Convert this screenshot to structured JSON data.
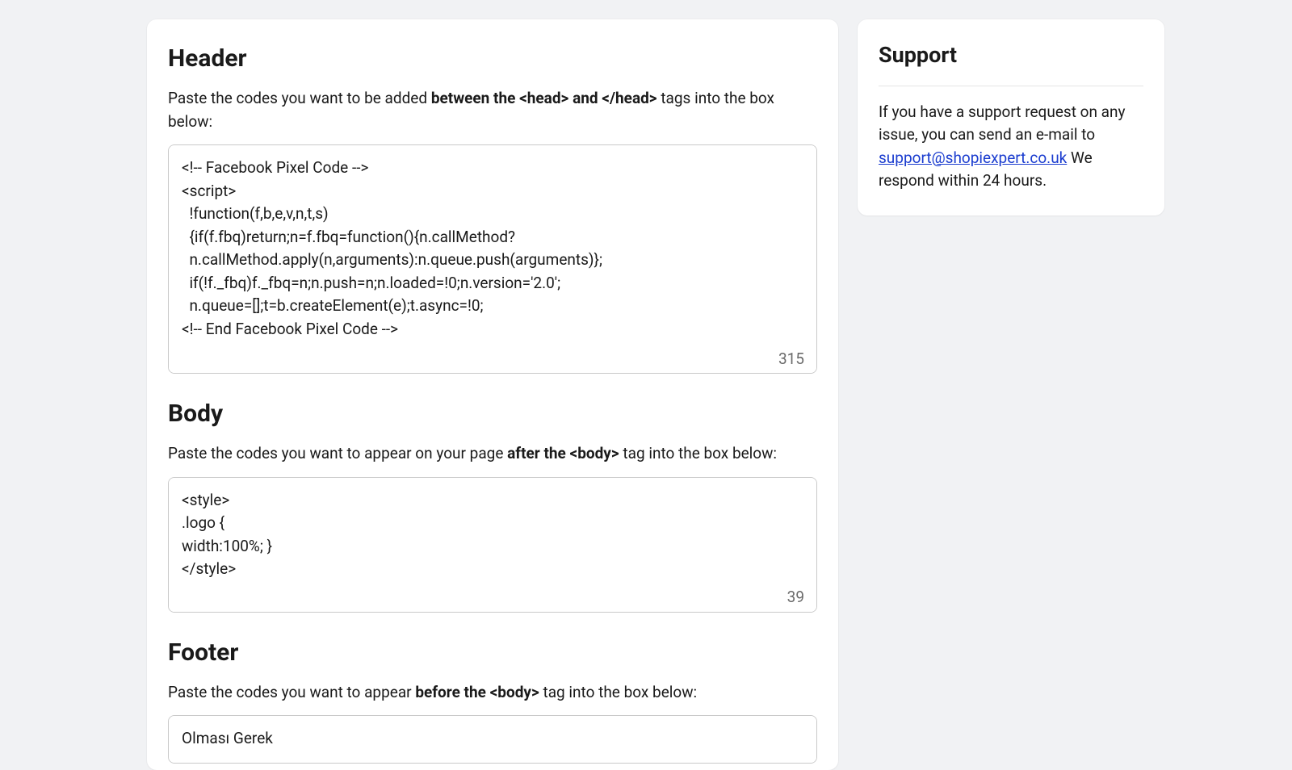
{
  "main": {
    "header_section": {
      "title": "Header",
      "desc_before": "Paste the codes you want to be added ",
      "desc_bold": "between the <head> and </head>",
      "desc_after": " tags into the box below:",
      "value": "<!-- Facebook Pixel Code -->\n<script>\n  !function(f,b,e,v,n,t,s)\n  {if(f.fbq)return;n=f.fbq=function(){n.callMethod?\n  n.callMethod.apply(n,arguments):n.queue.push(arguments)};\n  if(!f._fbq)f._fbq=n;n.push=n;n.loaded=!0;n.version='2.0';\n  n.queue=[];t=b.createElement(e);t.async=!0;\n<!-- End Facebook Pixel Code -->",
      "char_count": "315"
    },
    "body_section": {
      "title": "Body",
      "desc_before": "Paste the codes you want to appear on your page ",
      "desc_bold": "after the <body>",
      "desc_after": " tag into the box below:",
      "value": "<style>\n.logo {\nwidth:100%; }\n</style>",
      "char_count": "39"
    },
    "footer_section": {
      "title": "Footer",
      "desc_before": "Paste the codes you want to appear ",
      "desc_bold": "before the <body>",
      "desc_after": " tag into the box below:",
      "value": "Olması Gerek"
    }
  },
  "support": {
    "title": "Support",
    "text_before": "If you have a support request on any issue, you can send an e-mail to ",
    "email": "support@shopiexpert.co.uk",
    "text_after": " We respond within 24 hours."
  }
}
